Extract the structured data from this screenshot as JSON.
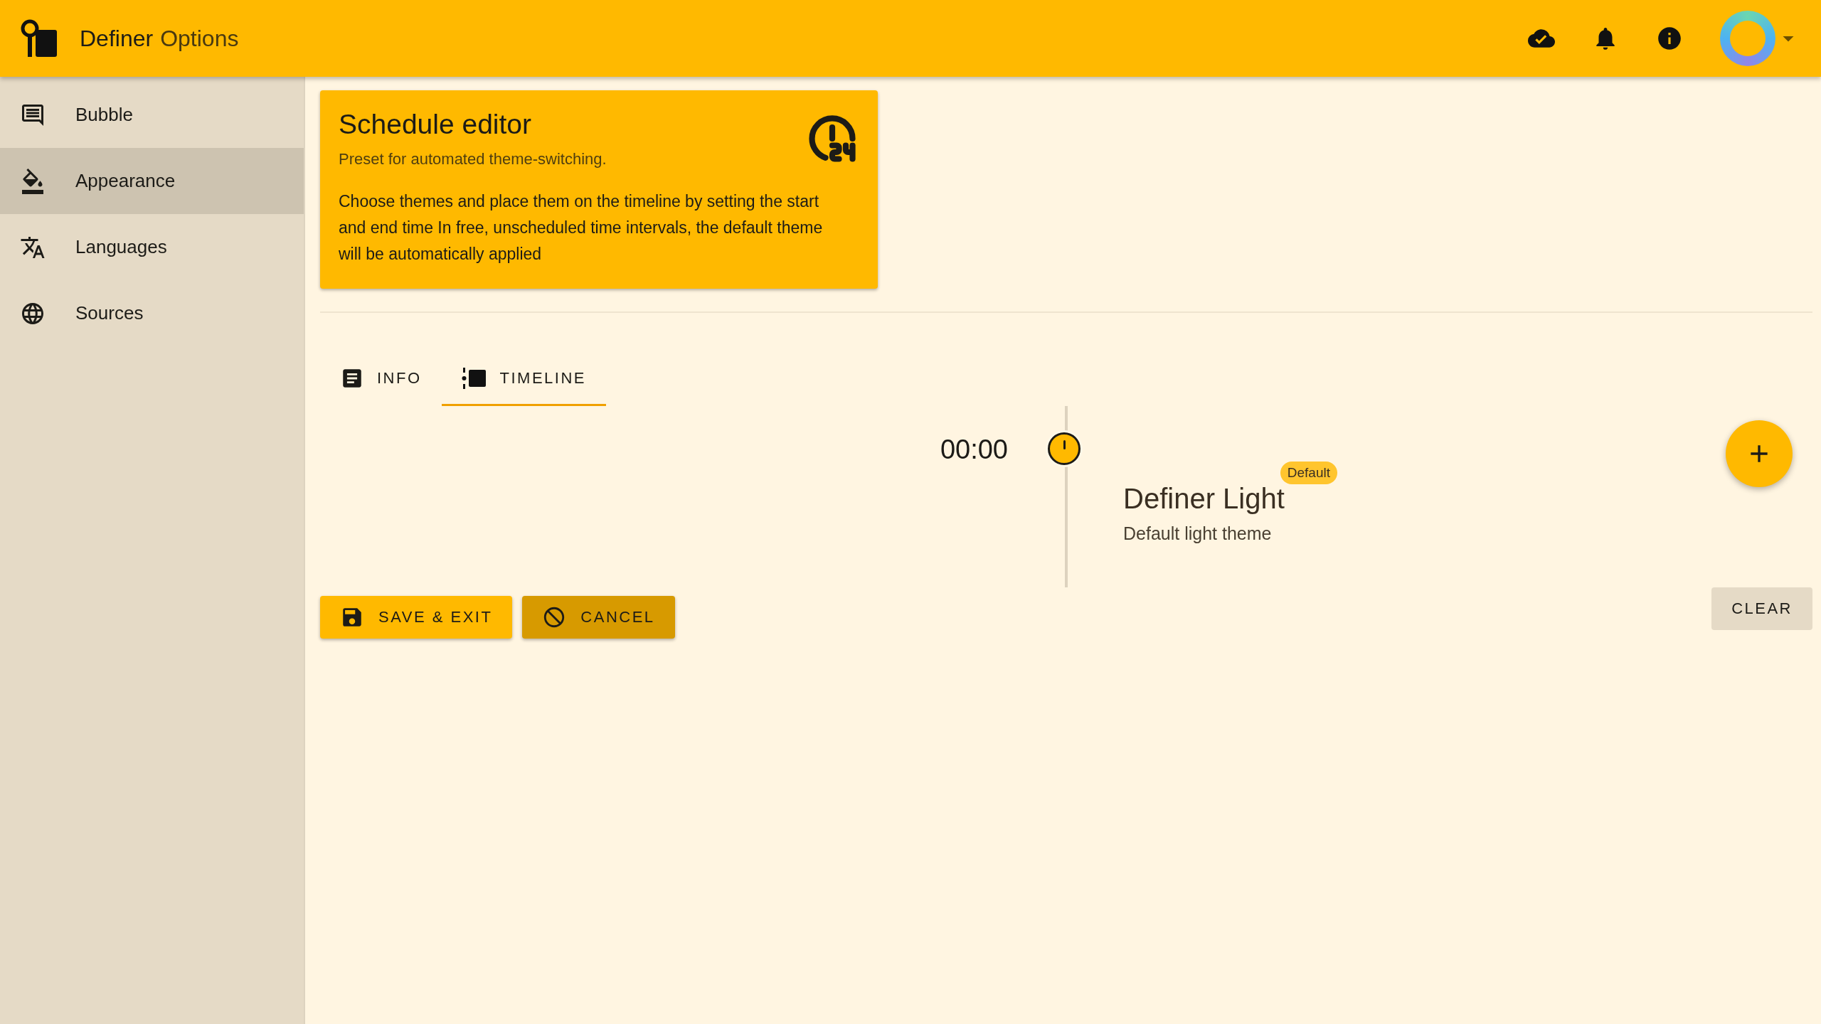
{
  "app_bar": {
    "title": "Definer",
    "subtitle": "Options"
  },
  "sidebar": {
    "items": [
      {
        "label": "Bubble",
        "selected": false
      },
      {
        "label": "Appearance",
        "selected": true
      },
      {
        "label": "Languages",
        "selected": false
      },
      {
        "label": "Sources",
        "selected": false
      }
    ]
  },
  "card": {
    "title": "Schedule editor",
    "subtitle": "Preset for automated theme-switching.",
    "description": "Choose themes and place them on the timeline by setting the start and end time In free, unscheduled time intervals, the default theme will be automatically applied"
  },
  "tabs": [
    {
      "label": "INFO",
      "selected": false
    },
    {
      "label": "TIMELINE",
      "selected": true
    }
  ],
  "timeline": {
    "entries": [
      {
        "time": "00:00",
        "name": "Definer Light",
        "description": "Default light theme",
        "badge": "Default"
      }
    ]
  },
  "actions": {
    "save": "SAVE & EXIT",
    "cancel": "CANCEL",
    "clear": "CLEAR"
  }
}
